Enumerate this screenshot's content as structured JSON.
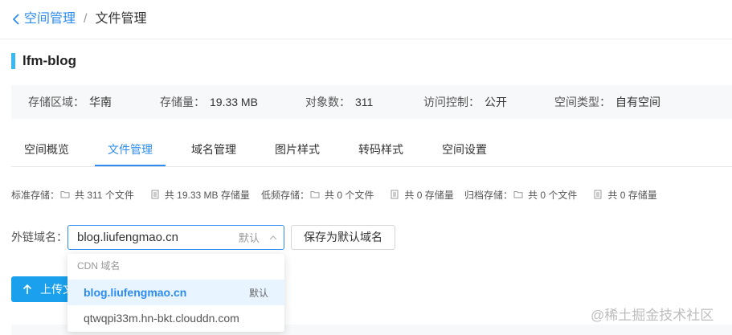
{
  "colors": {
    "accent": "#2d8cf0",
    "title_bar": "#3ab8f2",
    "upload_button": "#1aa0ec",
    "selected_option_bg": "#e8f4ff",
    "panel_bg": "#f7f8fa"
  },
  "breadcrumb": {
    "back_icon": "chevron-left-icon",
    "parent": "空间管理",
    "separator": "/",
    "current": "文件管理"
  },
  "bucket": {
    "name": "lfm-blog"
  },
  "info": [
    {
      "label": "存储区域：",
      "value": "华南"
    },
    {
      "label": "存储量：",
      "value": "19.33 MB"
    },
    {
      "label": "对象数：",
      "value": "311"
    },
    {
      "label": "访问控制：",
      "value": "公开"
    },
    {
      "label": "空间类型：",
      "value": "自有空间"
    }
  ],
  "tabs": [
    {
      "label": "空间概览",
      "active": false
    },
    {
      "label": "文件管理",
      "active": true
    },
    {
      "label": "域名管理",
      "active": false
    },
    {
      "label": "图片样式",
      "active": false
    },
    {
      "label": "转码样式",
      "active": false
    },
    {
      "label": "空间设置",
      "active": false
    }
  ],
  "stats": [
    {
      "label": "标准存储：",
      "files_icon": "folder-icon",
      "files": "共 311 个文件",
      "size_icon": "file-icon",
      "size": "共 19.33 MB 存储量"
    },
    {
      "label": "低频存储：",
      "files_icon": "folder-icon",
      "files": "共 0 个文件",
      "size_icon": "file-icon",
      "size": "共 0 存储量"
    },
    {
      "label": "归档存储：",
      "files_icon": "folder-icon",
      "files": "共 0 个文件",
      "size_icon": "file-icon",
      "size": "共 0 存储量"
    }
  ],
  "domain": {
    "label": "外链域名：",
    "value": "blog.liufengmao.cn",
    "default_tag": "默认",
    "chevron_icon": "chevron-up-icon",
    "save_button": "保存为默认域名",
    "dropdown": {
      "group_label": "CDN 域名",
      "options": [
        {
          "label": "blog.liufengmao.cn",
          "tag": "默认",
          "selected": true
        },
        {
          "label": "qtwqpi33m.hn-bkt.clouddn.com",
          "selected": false
        }
      ]
    }
  },
  "upload_button": {
    "icon": "arrow-up-icon",
    "label": "上传文"
  },
  "watermark": "@稀土掘金技术社区"
}
